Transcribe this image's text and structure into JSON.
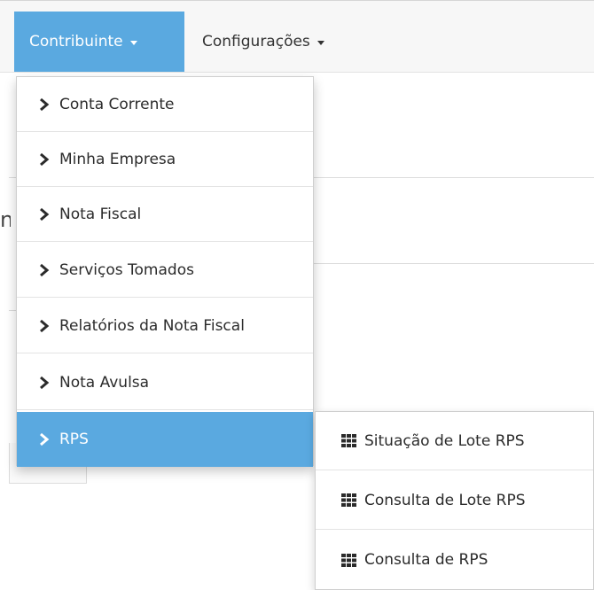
{
  "navbar": {
    "tabs": [
      {
        "label": "Contribuinte"
      },
      {
        "label": "Configurações"
      }
    ]
  },
  "background": {
    "partial_letter": "n"
  },
  "dropdown": {
    "items": [
      {
        "label": "Conta Corrente"
      },
      {
        "label": "Minha Empresa"
      },
      {
        "label": "Nota Fiscal"
      },
      {
        "label": "Serviços Tomados"
      },
      {
        "label": "Relatórios da Nota Fiscal"
      },
      {
        "label": "Nota Avulsa"
      },
      {
        "label": "RPS"
      }
    ]
  },
  "submenu": {
    "items": [
      {
        "label": "Situação de Lote RPS"
      },
      {
        "label": "Consulta de Lote RPS"
      },
      {
        "label": "Consulta de RPS"
      }
    ]
  },
  "colors": {
    "accent": "#5aa9e0",
    "text": "#2b2b2b"
  }
}
